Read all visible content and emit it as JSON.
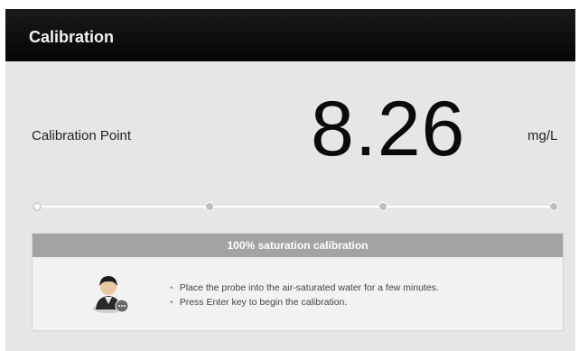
{
  "window": {
    "title": "Calibration"
  },
  "calibration": {
    "label": "Calibration Point",
    "value": "8.26",
    "unit": "mg/L"
  },
  "progress": {
    "steps": 4,
    "active_step": 1
  },
  "panel": {
    "header": "100% saturation calibration",
    "instructions": [
      "Place the probe into the air-saturated water for a few minutes.",
      "Press Enter key to begin the calibration."
    ],
    "icon": "user-avatar-icon"
  },
  "colors": {
    "titlebar": "#0a0a0a",
    "background": "#e6e6e6",
    "panel_header": "#a3a3a3"
  }
}
